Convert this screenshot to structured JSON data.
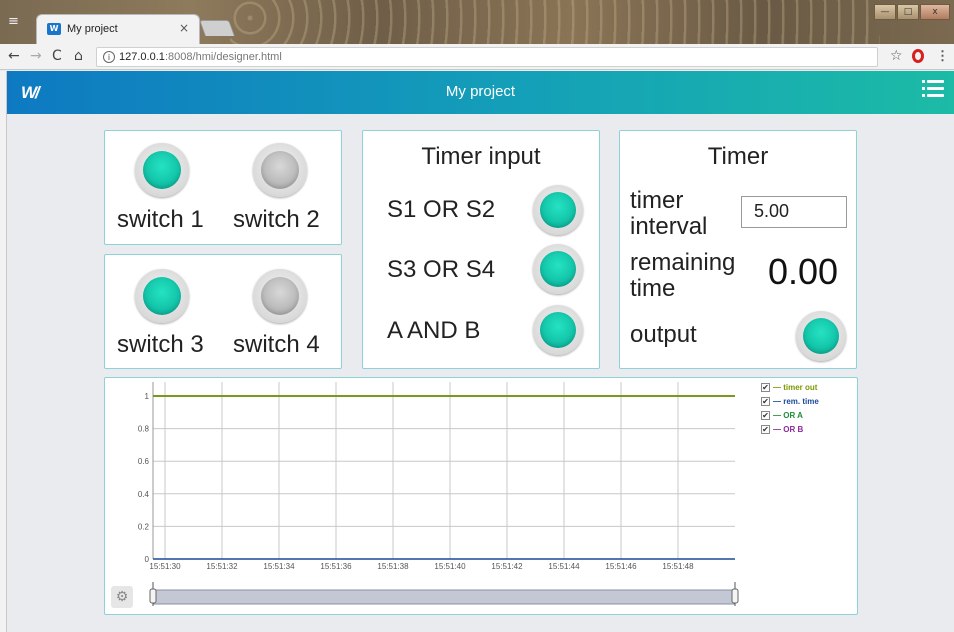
{
  "browser": {
    "tab_title": "My project",
    "tab_close": "×",
    "url_host": "127.0.0.1",
    "url_rest": ":8008/hmi/designer.html",
    "nav_back": "←",
    "nav_forward": "→",
    "nav_reload": "C",
    "nav_home": "⌂",
    "bookmark": "☆",
    "menu": "⋮",
    "info": "i"
  },
  "app": {
    "logo": "W/",
    "title": "My project"
  },
  "switches_a": {
    "s1": {
      "label": "switch 1",
      "state": "on"
    },
    "s2": {
      "label": "switch 2",
      "state": "off"
    }
  },
  "switches_b": {
    "s3": {
      "label": "switch 3",
      "state": "on"
    },
    "s4": {
      "label": "switch 4",
      "state": "off"
    }
  },
  "timer_input": {
    "title": "Timer input",
    "rows": [
      {
        "label": "S1 OR S2",
        "state": "on"
      },
      {
        "label": "S3 OR S4",
        "state": "on"
      },
      {
        "label": "A AND B",
        "state": "on"
      }
    ]
  },
  "timer": {
    "title": "Timer",
    "interval_label_1": "timer",
    "interval_label_2": "interval",
    "interval_value": "5.00",
    "remaining_label_1": "remaining",
    "remaining_label_2": "time",
    "remaining_value": "0.00",
    "output_label": "output",
    "output_state": "on"
  },
  "chart_data": {
    "type": "line",
    "x_ticks": [
      "15:51:30",
      "15:51:32",
      "15:51:34",
      "15:51:36",
      "15:51:38",
      "15:51:40",
      "15:51:42",
      "15:51:44",
      "15:51:46",
      "15:51:48"
    ],
    "y_ticks": [
      "0",
      "0.2",
      "0.4",
      "0.6",
      "0.8",
      "1"
    ],
    "ylim": [
      0,
      1
    ],
    "series": [
      {
        "name": "timer out",
        "color": "#7a9a00",
        "checked": true,
        "value": 1
      },
      {
        "name": "rem. time",
        "color": "#1a4a9a",
        "checked": true,
        "value": 0
      },
      {
        "name": "OR A",
        "color": "#1e8c3a",
        "checked": true,
        "value": 1
      },
      {
        "name": "OR B",
        "color": "#8a2a9a",
        "checked": true,
        "value": 1
      }
    ],
    "grid": true,
    "legend_position": "top-right"
  },
  "chart_ui": {
    "settings_icon": "⚙"
  }
}
